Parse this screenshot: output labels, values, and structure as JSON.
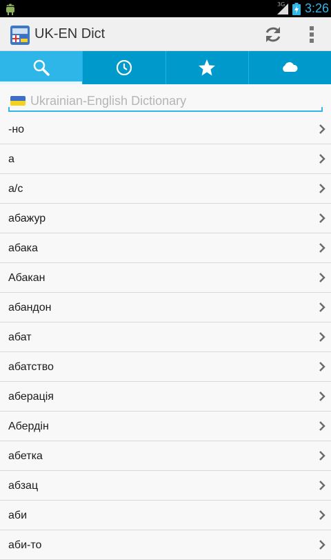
{
  "status_bar": {
    "network": "3G",
    "time": "3:26"
  },
  "action_bar": {
    "title": "UK-EN Dict",
    "app_icon": "dictionary-app-icon",
    "sync_icon": "sync-icon",
    "menu_icon": "overflow-menu-icon"
  },
  "tabs": [
    {
      "icon": "search-icon",
      "active": true
    },
    {
      "icon": "history-clock-icon",
      "active": false
    },
    {
      "icon": "favorites-star-icon",
      "active": false
    },
    {
      "icon": "cloud-icon",
      "active": false
    }
  ],
  "search": {
    "placeholder": "Ukrainian-English Dictionary",
    "value": ""
  },
  "words": [
    "-но",
    "а",
    "а/с",
    "абажур",
    "абака",
    "Абакан",
    "абандон",
    "абат",
    "абатство",
    "аберація",
    "Абердін",
    "абетка",
    "абзац",
    "аби",
    "аби-то"
  ],
  "colors": {
    "tab_bar": "#0099cc",
    "tab_active": "#2fb6e8",
    "accent": "#33b5e5",
    "flag_blue": "#3e6ec9",
    "flag_yellow": "#f4d21f"
  }
}
